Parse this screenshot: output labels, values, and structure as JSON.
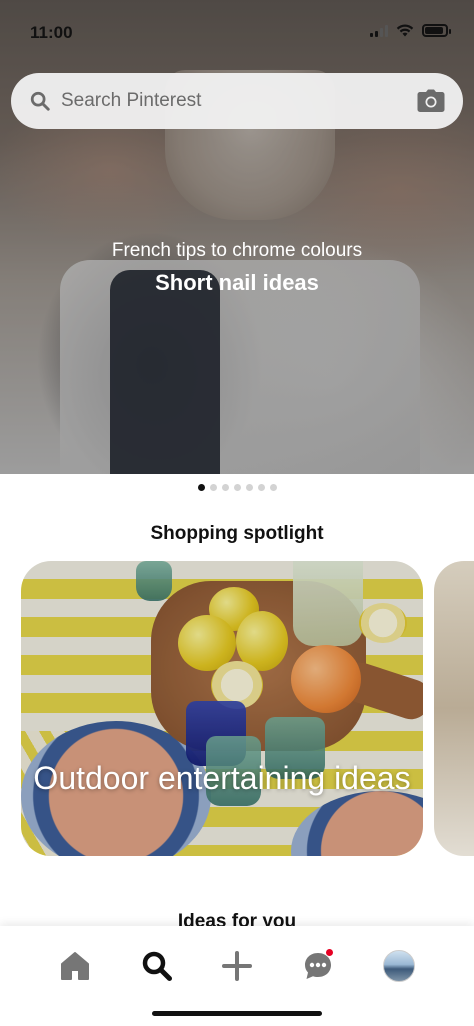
{
  "status_bar": {
    "time": "11:00"
  },
  "search": {
    "placeholder": "Search Pinterest"
  },
  "hero": {
    "subtitle": "French tips to chrome colours",
    "title": "Short nail ideas",
    "dots_total": 7,
    "active_dot": 1
  },
  "shopping": {
    "section_title": "Shopping spotlight",
    "card_title": "Outdoor entertaining ideas"
  },
  "ideas": {
    "section_title": "Ideas for you"
  },
  "nav": {
    "items": [
      {
        "icon": "home-icon",
        "active": false
      },
      {
        "icon": "search-icon",
        "active": true
      },
      {
        "icon": "plus-icon",
        "active": false
      },
      {
        "icon": "chat-icon",
        "active": false,
        "badge": true
      },
      {
        "icon": "profile-avatar",
        "active": false
      }
    ]
  },
  "colors": {
    "badge": "#e60023",
    "text": "#111111",
    "inactive_icon": "#767676"
  }
}
